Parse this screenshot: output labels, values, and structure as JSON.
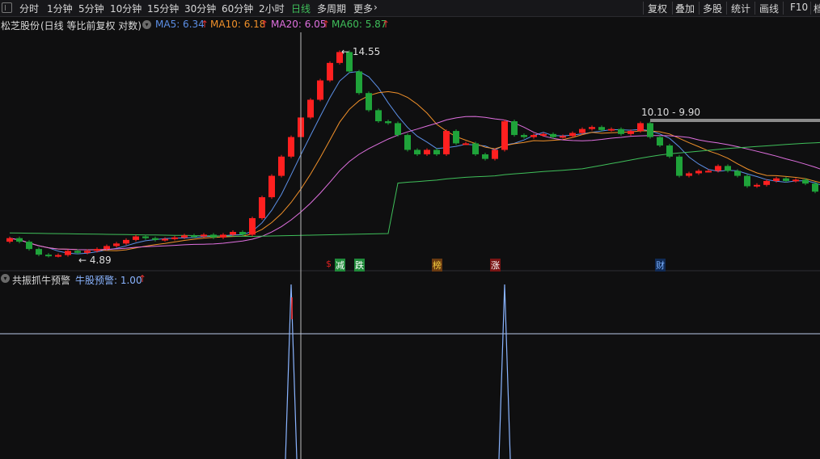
{
  "toolbar": {
    "periods": [
      "分时",
      "1分钟",
      "5分钟",
      "10分钟",
      "15分钟",
      "30分钟",
      "60分钟",
      "2小时",
      "日线",
      "多周期",
      "更多"
    ],
    "more_arrow": "›",
    "active_period": "日线",
    "right_buttons": [
      "复权",
      "叠加",
      "多股",
      "统计",
      "画线",
      "F10",
      "档"
    ]
  },
  "stock_info": {
    "name": "松芝股份",
    "mode": "(日线 等比前复权 对数)",
    "ma5": {
      "label": "MA5: 6.34",
      "arrow": "↑",
      "color": "#5c8fe6"
    },
    "ma10": {
      "label": "MA10: 6.18",
      "arrow": "↑",
      "color": "#f0902a"
    },
    "ma20": {
      "label": "MA20: 6.05",
      "arrow": "↑",
      "color": "#e070e0"
    },
    "ma60": {
      "label": "MA60: 5.87",
      "arrow": "↑",
      "color": "#3fbf5a"
    }
  },
  "chart_data": {
    "type": "candlestick",
    "high_label": "14.55",
    "low_label": "4.89",
    "range_label": "10.10 - 9.90",
    "candles": [
      {
        "o": 5.3,
        "c": 5.4
      },
      {
        "o": 5.4,
        "c": 5.3
      },
      {
        "o": 5.3,
        "c": 5.1
      },
      {
        "o": 5.1,
        "c": 4.95
      },
      {
        "o": 4.95,
        "c": 4.92
      },
      {
        "o": 4.92,
        "c": 4.94
      },
      {
        "o": 4.94,
        "c": 5.05
      },
      {
        "o": 5.05,
        "c": 5.0
      },
      {
        "o": 5.0,
        "c": 5.05
      },
      {
        "o": 5.05,
        "c": 5.1
      },
      {
        "o": 5.1,
        "c": 5.18
      },
      {
        "o": 5.18,
        "c": 5.25
      },
      {
        "o": 5.25,
        "c": 5.35
      },
      {
        "o": 5.35,
        "c": 5.45
      },
      {
        "o": 5.45,
        "c": 5.4
      },
      {
        "o": 5.4,
        "c": 5.35
      },
      {
        "o": 5.35,
        "c": 5.38
      },
      {
        "o": 5.38,
        "c": 5.42
      },
      {
        "o": 5.42,
        "c": 5.48
      },
      {
        "o": 5.48,
        "c": 5.45
      },
      {
        "o": 5.45,
        "c": 5.5
      },
      {
        "o": 5.5,
        "c": 5.42
      },
      {
        "o": 5.42,
        "c": 5.5
      },
      {
        "o": 5.5,
        "c": 5.58
      },
      {
        "o": 5.58,
        "c": 5.5
      },
      {
        "o": 5.5,
        "c": 6.0
      },
      {
        "o": 6.0,
        "c": 6.7
      },
      {
        "o": 6.7,
        "c": 7.5
      },
      {
        "o": 7.5,
        "c": 8.3
      },
      {
        "o": 8.3,
        "c": 9.2
      },
      {
        "o": 9.2,
        "c": 10.2
      },
      {
        "o": 10.2,
        "c": 11.2
      },
      {
        "o": 11.2,
        "c": 12.4
      },
      {
        "o": 12.4,
        "c": 13.6
      },
      {
        "o": 13.6,
        "c": 14.4
      },
      {
        "o": 14.4,
        "c": 13.0
      },
      {
        "o": 13.0,
        "c": 11.6
      },
      {
        "o": 11.6,
        "c": 10.6
      },
      {
        "o": 10.6,
        "c": 10.0
      },
      {
        "o": 10.0,
        "c": 9.9
      },
      {
        "o": 9.9,
        "c": 9.3
      },
      {
        "o": 9.3,
        "c": 8.6
      },
      {
        "o": 8.6,
        "c": 8.4
      },
      {
        "o": 8.4,
        "c": 8.6
      },
      {
        "o": 8.6,
        "c": 8.4
      },
      {
        "o": 8.4,
        "c": 9.5
      },
      {
        "o": 9.5,
        "c": 8.9
      },
      {
        "o": 8.9,
        "c": 8.9
      },
      {
        "o": 8.9,
        "c": 8.4
      },
      {
        "o": 8.4,
        "c": 8.2
      },
      {
        "o": 8.2,
        "c": 8.6
      },
      {
        "o": 8.6,
        "c": 10.0
      },
      {
        "o": 10.0,
        "c": 9.3
      },
      {
        "o": 9.3,
        "c": 9.2
      },
      {
        "o": 9.2,
        "c": 9.3
      },
      {
        "o": 9.3,
        "c": 9.35
      },
      {
        "o": 9.35,
        "c": 9.2
      },
      {
        "o": 9.2,
        "c": 9.25
      },
      {
        "o": 9.25,
        "c": 9.4
      },
      {
        "o": 9.4,
        "c": 9.6
      },
      {
        "o": 9.6,
        "c": 9.7
      },
      {
        "o": 9.7,
        "c": 9.55
      },
      {
        "o": 9.55,
        "c": 9.6
      },
      {
        "o": 9.6,
        "c": 9.35
      },
      {
        "o": 9.35,
        "c": 9.5
      },
      {
        "o": 9.5,
        "c": 9.9
      },
      {
        "o": 9.9,
        "c": 9.2
      },
      {
        "o": 9.2,
        "c": 8.8
      },
      {
        "o": 8.8,
        "c": 8.3
      },
      {
        "o": 8.3,
        "c": 7.5
      },
      {
        "o": 7.5,
        "c": 7.6
      },
      {
        "o": 7.6,
        "c": 7.7
      },
      {
        "o": 7.7,
        "c": 7.7
      },
      {
        "o": 7.7,
        "c": 7.9
      },
      {
        "o": 7.9,
        "c": 7.7
      },
      {
        "o": 7.7,
        "c": 7.5
      },
      {
        "o": 7.5,
        "c": 7.1
      },
      {
        "o": 7.1,
        "c": 7.15
      },
      {
        "o": 7.15,
        "c": 7.3
      },
      {
        "o": 7.3,
        "c": 7.4
      },
      {
        "o": 7.4,
        "c": 7.3
      },
      {
        "o": 7.3,
        "c": 7.35
      },
      {
        "o": 7.35,
        "c": 7.2
      },
      {
        "o": 7.2,
        "c": 6.9
      },
      {
        "o": 6.9,
        "c": 6.7
      }
    ],
    "signals": [
      {
        "text": "$",
        "index": 33,
        "color": "#e02020",
        "bg": "transparent"
      },
      {
        "text": "减",
        "index": 34,
        "color": "#ffffff",
        "bg": "#1f8a3a"
      },
      {
        "text": "跌",
        "index": 36,
        "color": "#ffffff",
        "bg": "#1f8a3a"
      },
      {
        "text": "榜",
        "index": 44,
        "color": "#f5d040",
        "bg": "#6a3a10"
      },
      {
        "text": "涨",
        "index": 50,
        "color": "#ffffff",
        "bg": "#7a1414"
      },
      {
        "text": "财",
        "index": 67,
        "color": "#7ab0ff",
        "bg": "#102a55"
      }
    ]
  },
  "indicator": {
    "name": "共振抓牛预警",
    "label": "牛股预警: 1.00",
    "arrow": "↑",
    "color": "#8ab4ff",
    "spikes": [
      29,
      51
    ]
  }
}
